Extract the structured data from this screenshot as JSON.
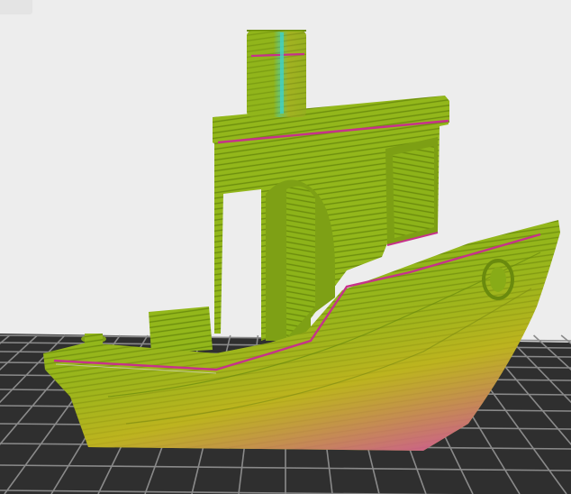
{
  "viewer": {
    "background_color": "#ededed",
    "bed_color": "#2e2e2e",
    "grid_line_color": "#8f8f8f",
    "model_base_color": "#8fb21a",
    "model_layer_color": "#6e8f10",
    "bottom_gradient_colors": [
      "#c8b21a",
      "#d35aa0"
    ],
    "seam_color": "#c6328a",
    "highlight_color": "#3fd1c8"
  },
  "model": {
    "name_icon": "3d-boat-model-icon"
  }
}
